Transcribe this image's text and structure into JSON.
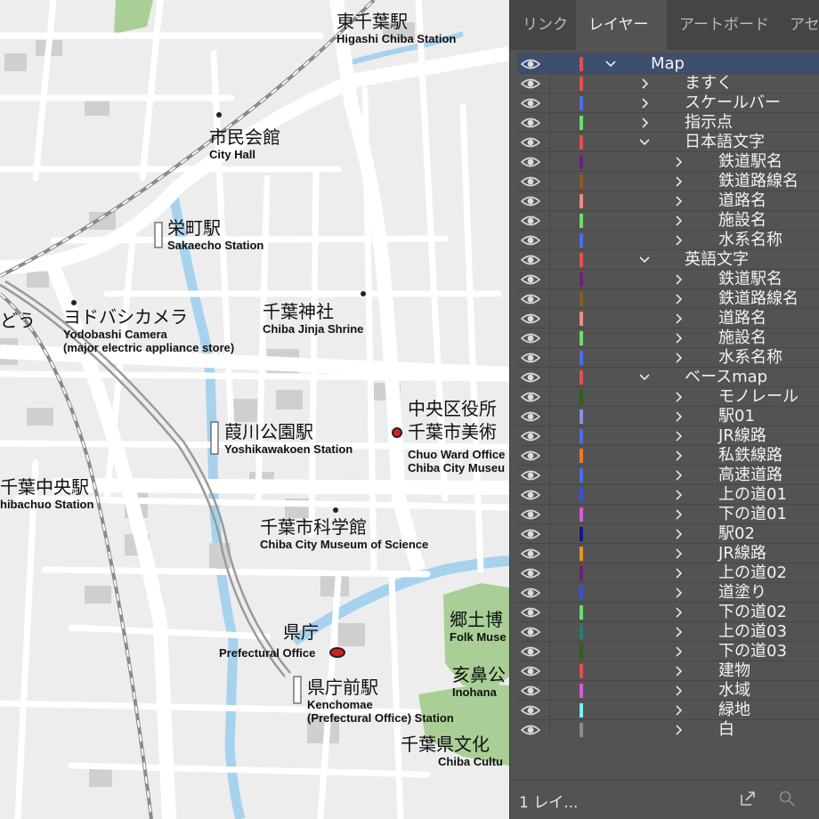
{
  "map": {
    "labels": [
      {
        "ja": "東千葉駅",
        "en": "Higashi Chiba Station"
      },
      {
        "ja": "市民会館",
        "en": "City Hall"
      },
      {
        "ja": "栄町駅",
        "en": "Sakaecho Station"
      },
      {
        "ja": "千葉神社",
        "en": "Chiba Jinja Shrine"
      },
      {
        "ja": "ヨドバシカメラ",
        "en": "Yodobashi Camera"
      },
      {
        "ja": "",
        "en": "(major electric appliance store)"
      },
      {
        "ja": "葭川公園駅",
        "en": "Yoshikawakoen Station"
      },
      {
        "ja": "中央区役所",
        "en": "Chuo Ward Office"
      },
      {
        "ja": "千葉市美術",
        "en": "Chiba City Museu"
      },
      {
        "ja": "千葉中央駅",
        "en": "hibachuo Station"
      },
      {
        "ja": "千葉市科学館",
        "en": "Chiba City Museum of Science"
      },
      {
        "ja": "県庁",
        "en": "Prefectural Office"
      },
      {
        "ja": "県庁前駅",
        "en": "Kenchomae"
      },
      {
        "ja": "",
        "en": "(Prefectural Office) Station"
      },
      {
        "ja": "郷土博",
        "en": "Folk Muse"
      },
      {
        "ja": "亥鼻公",
        "en": "Inohana"
      },
      {
        "ja": "千葉県文化",
        "en": "Chiba Cultu"
      },
      {
        "ja": "どう",
        "en": ""
      }
    ]
  },
  "panel": {
    "tabs": [
      "リンク",
      "レイヤー",
      "アートボード",
      "アセ"
    ],
    "active_tab": 1,
    "layers": [
      {
        "name": "Map",
        "depth": 0,
        "expanded": true,
        "color": "#e05050",
        "selected": true
      },
      {
        "name": "ますく",
        "depth": 1,
        "expanded": false,
        "color": "#e05050"
      },
      {
        "name": "スケールバー",
        "depth": 1,
        "expanded": false,
        "color": "#4b6ee6"
      },
      {
        "name": "指示点",
        "depth": 1,
        "expanded": false,
        "color": "#6fdc6f"
      },
      {
        "name": "日本語文字",
        "depth": 1,
        "expanded": true,
        "color": "#e05050"
      },
      {
        "name": "鉄道駅名",
        "depth": 2,
        "expanded": false,
        "color": "#6a2378"
      },
      {
        "name": "鉄道路線名",
        "depth": 2,
        "expanded": false,
        "color": "#8a5a1e"
      },
      {
        "name": "道路名",
        "depth": 2,
        "expanded": false,
        "color": "#f08a8a"
      },
      {
        "name": "施設名",
        "depth": 2,
        "expanded": false,
        "color": "#6fdc6f"
      },
      {
        "name": "水系名称",
        "depth": 2,
        "expanded": false,
        "color": "#4b6ee6"
      },
      {
        "name": "英語文字",
        "depth": 1,
        "expanded": true,
        "color": "#e05050"
      },
      {
        "name": "鉄道駅名",
        "depth": 2,
        "expanded": false,
        "color": "#6a2378"
      },
      {
        "name": "鉄道路線名",
        "depth": 2,
        "expanded": false,
        "color": "#8a5a1e"
      },
      {
        "name": "道路名",
        "depth": 2,
        "expanded": false,
        "color": "#f08a8a"
      },
      {
        "name": "施設名",
        "depth": 2,
        "expanded": false,
        "color": "#6fdc6f"
      },
      {
        "name": "水系名称",
        "depth": 2,
        "expanded": false,
        "color": "#4b6ee6"
      },
      {
        "name": "ベースmap",
        "depth": 1,
        "expanded": true,
        "color": "#e05050"
      },
      {
        "name": "モノレール",
        "depth": 2,
        "expanded": false,
        "color": "#2f5e1c"
      },
      {
        "name": "駅01",
        "depth": 2,
        "expanded": false,
        "color": "#8c8ce0"
      },
      {
        "name": "JR線路",
        "depth": 2,
        "expanded": false,
        "color": "#4b6ee6"
      },
      {
        "name": "私鉄線路",
        "depth": 2,
        "expanded": false,
        "color": "#e8792a"
      },
      {
        "name": "高速道路",
        "depth": 2,
        "expanded": false,
        "color": "#4b6ee6"
      },
      {
        "name": "上の道01",
        "depth": 2,
        "expanded": false,
        "color": "#3d4fd8"
      },
      {
        "name": "下の道01",
        "depth": 2,
        "expanded": false,
        "color": "#d85ad8"
      },
      {
        "name": "駅02",
        "depth": 2,
        "expanded": false,
        "color": "#101a8a"
      },
      {
        "name": "JR線路",
        "depth": 2,
        "expanded": false,
        "color": "#e8922a"
      },
      {
        "name": "上の道02",
        "depth": 2,
        "expanded": false,
        "color": "#6a2378"
      },
      {
        "name": "道塗り",
        "depth": 2,
        "expanded": false,
        "color": "#3d4fd8"
      },
      {
        "name": "下の道02",
        "depth": 2,
        "expanded": false,
        "color": "#6fdc6f"
      },
      {
        "name": "上の道03",
        "depth": 2,
        "expanded": false,
        "color": "#2c7a7a"
      },
      {
        "name": "下の道03",
        "depth": 2,
        "expanded": false,
        "color": "#2f5e1c"
      },
      {
        "name": "建物",
        "depth": 2,
        "expanded": false,
        "color": "#e05050"
      },
      {
        "name": "水域",
        "depth": 2,
        "expanded": false,
        "color": "#d85ad8"
      },
      {
        "name": "緑地",
        "depth": 2,
        "expanded": false,
        "color": "#7af0f0"
      },
      {
        "name": "白",
        "depth": 2,
        "expanded": false,
        "color": "#8a8a8a"
      }
    ],
    "footer": {
      "count_label": "1 レイ...",
      "icons": [
        "export-icon",
        "search-icon"
      ]
    }
  }
}
